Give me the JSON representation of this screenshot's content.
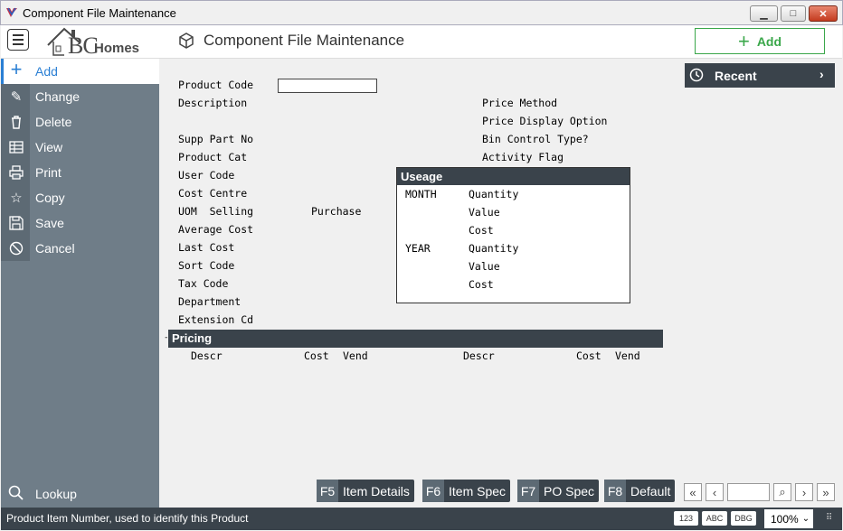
{
  "window": {
    "title": "Component File Maintenance",
    "min_glyph": "▁",
    "max_glyph": "□",
    "close_glyph": "✕"
  },
  "header": {
    "logo_bc": "BC",
    "logo_homes": "Homes",
    "page_title": "Component File Maintenance",
    "add_label": "Add",
    "add_icon": "+"
  },
  "sidebar": {
    "items": [
      {
        "label": "Add",
        "icon": "plus-icon",
        "glyph": "+"
      },
      {
        "label": "Change",
        "icon": "edit-icon",
        "glyph": "✎"
      },
      {
        "label": "Delete",
        "icon": "trash-icon",
        "glyph": "🗑"
      },
      {
        "label": "View",
        "icon": "table-icon",
        "glyph": "▦"
      },
      {
        "label": "Print",
        "icon": "printer-icon",
        "glyph": "⎙"
      },
      {
        "label": "Copy",
        "icon": "star-icon",
        "glyph": "☆"
      },
      {
        "label": "Save",
        "icon": "save-icon",
        "glyph": "💾"
      },
      {
        "label": "Cancel",
        "icon": "cancel-icon",
        "glyph": "⃠"
      }
    ],
    "lookup_label": "Lookup"
  },
  "form": {
    "product_code_label": "Product Code",
    "product_code_value": "",
    "description_label": "Description",
    "supp_part_no_label": "Supp Part No",
    "product_cat_label": "Product Cat",
    "user_code_label": "User Code",
    "cost_centre_label": "Cost Centre",
    "uom_selling_label": "UOM  Selling",
    "purchase_label": "Purchase",
    "average_cost_label": "Average Cost",
    "last_cost_label": "Last Cost",
    "sort_code_label": "Sort Code",
    "tax_code_label": "Tax Code",
    "department_label": "Department",
    "extension_cd_label": "Extension Cd",
    "price_method_label": "Price Method",
    "price_display_option_label": "Price Display Option",
    "bin_control_type_label": "Bin Control Type?",
    "activity_flag_label": "Activity Flag"
  },
  "useage": {
    "title": "Useage",
    "month_label": "MONTH",
    "year_label": "YEAR",
    "quantity_label": "Quantity",
    "value_label": "Value",
    "cost_label": "Cost"
  },
  "pricing": {
    "title": "Pricing",
    "marker": "-",
    "columns_left": [
      "Descr",
      "Cost",
      "Vend"
    ],
    "columns_right": [
      "Descr",
      "Cost",
      "Vend"
    ]
  },
  "recent": {
    "label": "Recent",
    "chevron": "›"
  },
  "fkeys": [
    {
      "key": "F5",
      "label": "Item Details"
    },
    {
      "key": "F6",
      "label": "Item Spec"
    },
    {
      "key": "F7",
      "label": "PO Spec"
    },
    {
      "key": "F8",
      "label": "Default"
    }
  ],
  "nav": {
    "first": "«",
    "prev": "‹",
    "search": "⌕",
    "next": "›",
    "last": "»",
    "page_value": ""
  },
  "status": {
    "message": "Product Item Number, used to identify this Product",
    "badges": [
      "123",
      "ABC",
      "DBG"
    ],
    "zoom": "100%",
    "zoom_chevron": "⌄",
    "grip": "⠿"
  },
  "colors": {
    "accent_blue": "#2a7fd4",
    "add_green": "#3aa74a",
    "dark_bar": "#3a434b",
    "sidebar": "#6f7d88"
  }
}
